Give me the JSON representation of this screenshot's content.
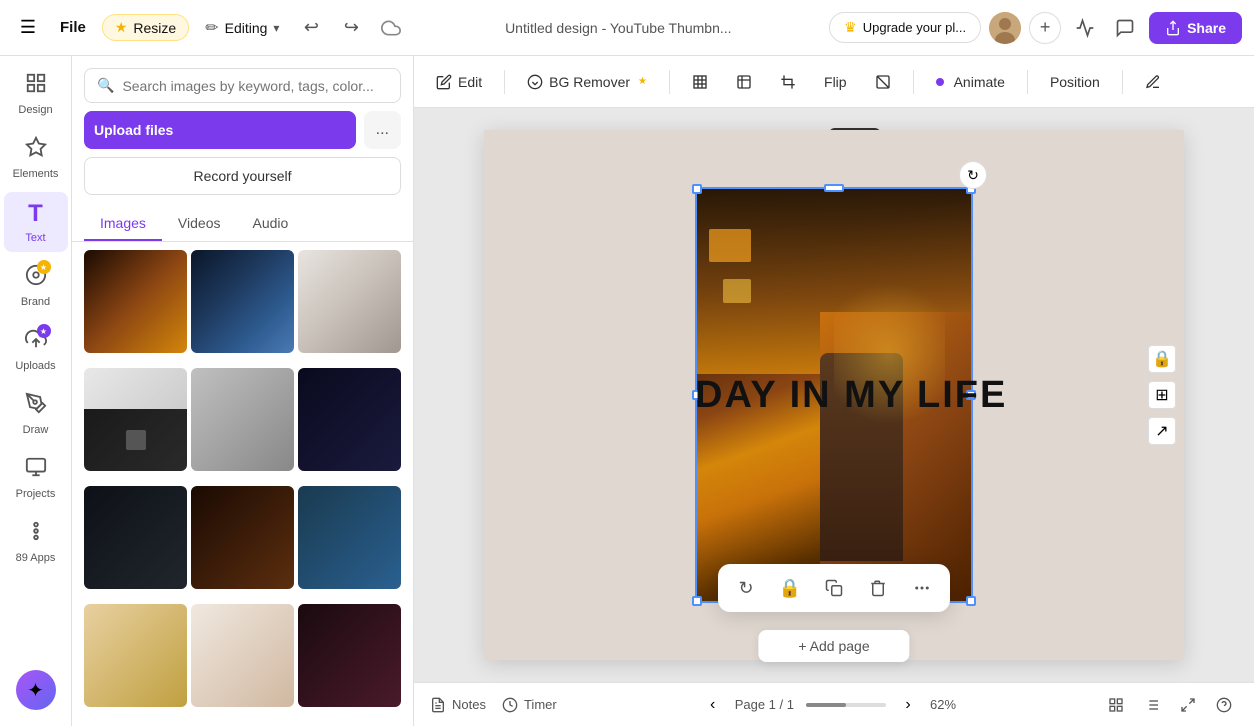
{
  "topbar": {
    "menu_label": "☰",
    "file_label": "File",
    "resize_label": "Resize",
    "editing_label": "Editing",
    "undo_label": "↩",
    "redo_label": "↪",
    "cloud_label": "☁",
    "title": "Untitled design - YouTube Thumbn...",
    "upgrade_label": "Upgrade your pl...",
    "plus_label": "+",
    "share_label": "Share"
  },
  "sidebar": {
    "items": [
      {
        "id": "design",
        "label": "Design",
        "icon": "⊞"
      },
      {
        "id": "elements",
        "label": "Elements",
        "icon": "✦"
      },
      {
        "id": "text",
        "label": "Text",
        "icon": "T"
      },
      {
        "id": "brand",
        "label": "Brand",
        "icon": "⊛",
        "badge": "star"
      },
      {
        "id": "uploads",
        "label": "Uploads",
        "icon": "↑",
        "badge": "purple"
      },
      {
        "id": "draw",
        "label": "Draw",
        "icon": "✏"
      },
      {
        "id": "projects",
        "label": "Projects",
        "icon": "⊟"
      },
      {
        "id": "apps",
        "label": "89 Apps",
        "icon": "⊕"
      }
    ],
    "magic_label": "✦"
  },
  "left_panel": {
    "search_placeholder": "Search images by keyword, tags, color...",
    "upload_label": "Upload files",
    "upload_more_label": "...",
    "record_label": "Record yourself",
    "tabs": [
      {
        "id": "images",
        "label": "Images",
        "active": true
      },
      {
        "id": "videos",
        "label": "Videos",
        "active": false
      },
      {
        "id": "audio",
        "label": "Audio",
        "active": false
      }
    ],
    "images": [
      {
        "id": 1,
        "class": "img-1"
      },
      {
        "id": 2,
        "class": "img-2"
      },
      {
        "id": 3,
        "class": "img-3"
      },
      {
        "id": 4,
        "class": "img-4"
      },
      {
        "id": 5,
        "class": "img-5"
      },
      {
        "id": 6,
        "class": "img-6"
      },
      {
        "id": 7,
        "class": "img-7"
      },
      {
        "id": 8,
        "class": "img-8"
      },
      {
        "id": 9,
        "class": "img-9"
      },
      {
        "id": 10,
        "class": "img-10"
      },
      {
        "id": 11,
        "class": "img-11"
      },
      {
        "id": 12,
        "class": "img-12"
      },
      {
        "id": 13,
        "class": "img-13"
      },
      {
        "id": 14,
        "class": "img-14"
      }
    ]
  },
  "toolbar": {
    "edit_label": "Edit",
    "bg_remover_label": "BG Remover",
    "flip_label": "Flip",
    "animate_label": "Animate",
    "position_label": "Position",
    "crop_label": "Crop"
  },
  "canvas": {
    "text": "DAY IN  MY LIFE",
    "add_page_label": "+ Add page"
  },
  "float_toolbar": {
    "rotate_label": "↻",
    "lock_label": "🔒",
    "copy_label": "⧉",
    "delete_label": "🗑",
    "more_label": "..."
  },
  "bottom_bar": {
    "notes_label": "Notes",
    "timer_label": "Timer",
    "page_info": "Page 1 / 1",
    "zoom_level": "62%"
  }
}
